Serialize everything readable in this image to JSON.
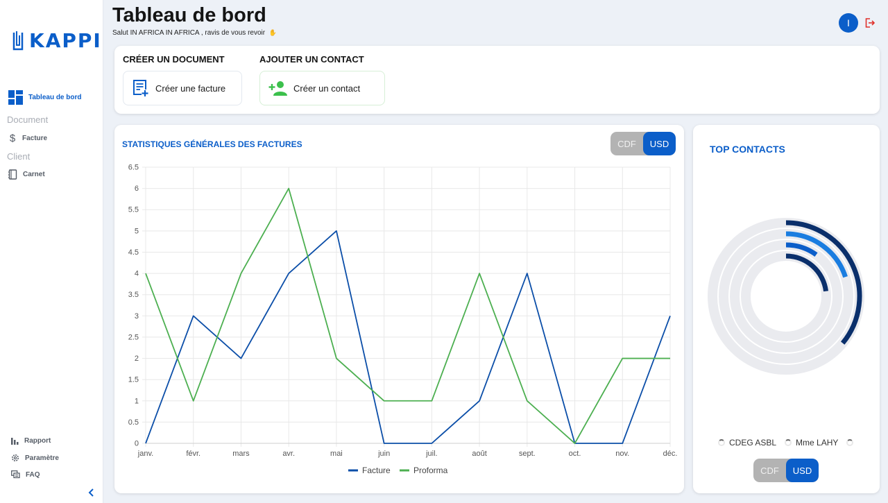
{
  "app": {
    "logo_text": "KAPPI"
  },
  "header": {
    "title": "Tableau de bord",
    "greeting": "Salut IN AFRICA IN AFRICA , ravis de vous revoir",
    "avatar_initial": "I"
  },
  "sidebar": {
    "dashboard_label": "Tableau de bord",
    "section_document": "Document",
    "invoice_label": "Facture",
    "section_client": "Client",
    "notebook_label": "Carnet",
    "report_label": "Rapport",
    "settings_label": "Paramètre",
    "faq_label": "FAQ"
  },
  "quick_actions": {
    "create_doc_title": "CRÉER UN DOCUMENT",
    "create_invoice_label": "Créer une facture",
    "add_contact_title": "AJOUTER UN CONTACT",
    "create_contact_label": "Créer un contact"
  },
  "stats": {
    "title": "STATISTIQUES GÉNÉRALES DES FACTURES",
    "currency_options": [
      "CDF",
      "USD"
    ],
    "selected_currency": "USD"
  },
  "contacts": {
    "title": "TOP CONTACTS",
    "legend": [
      "CDEG ASBL",
      "Mme LAHY",
      ""
    ],
    "currency_options": [
      "CDF",
      "USD"
    ],
    "selected_currency": "USD",
    "rings": [
      {
        "color": "#0a2f6b",
        "fraction": 0.36
      },
      {
        "color": "#1a7de0",
        "fraction": 0.2
      },
      {
        "color": "#0b5ec9",
        "fraction": 0.1
      },
      {
        "color": "#0a2f6b",
        "fraction": 0.23
      }
    ]
  },
  "colors": {
    "accent": "#0b5ec9",
    "facture": "#0b4ea8",
    "proforma": "#4caf50"
  },
  "chart_data": {
    "type": "line",
    "categories": [
      "janv.",
      "févr.",
      "mars",
      "avr.",
      "mai",
      "juin",
      "juil.",
      "août",
      "sept.",
      "oct.",
      "nov.",
      "déc."
    ],
    "series": [
      {
        "name": "Facture",
        "values": [
          0,
          3,
          2,
          4,
          5,
          0,
          0,
          1,
          4,
          0,
          0,
          3
        ]
      },
      {
        "name": "Proforma",
        "values": [
          4,
          1,
          4,
          6,
          2,
          1,
          1,
          4,
          1,
          0,
          2,
          2
        ]
      }
    ],
    "ylim": [
      0,
      6.5
    ],
    "yticks": [
      "0",
      "0.5",
      "1",
      "1.5",
      "2",
      "2.5",
      "3",
      "3.5",
      "4",
      "4.5",
      "5",
      "5.5",
      "6",
      "6.5"
    ],
    "grid": true,
    "legend": "bottom"
  }
}
